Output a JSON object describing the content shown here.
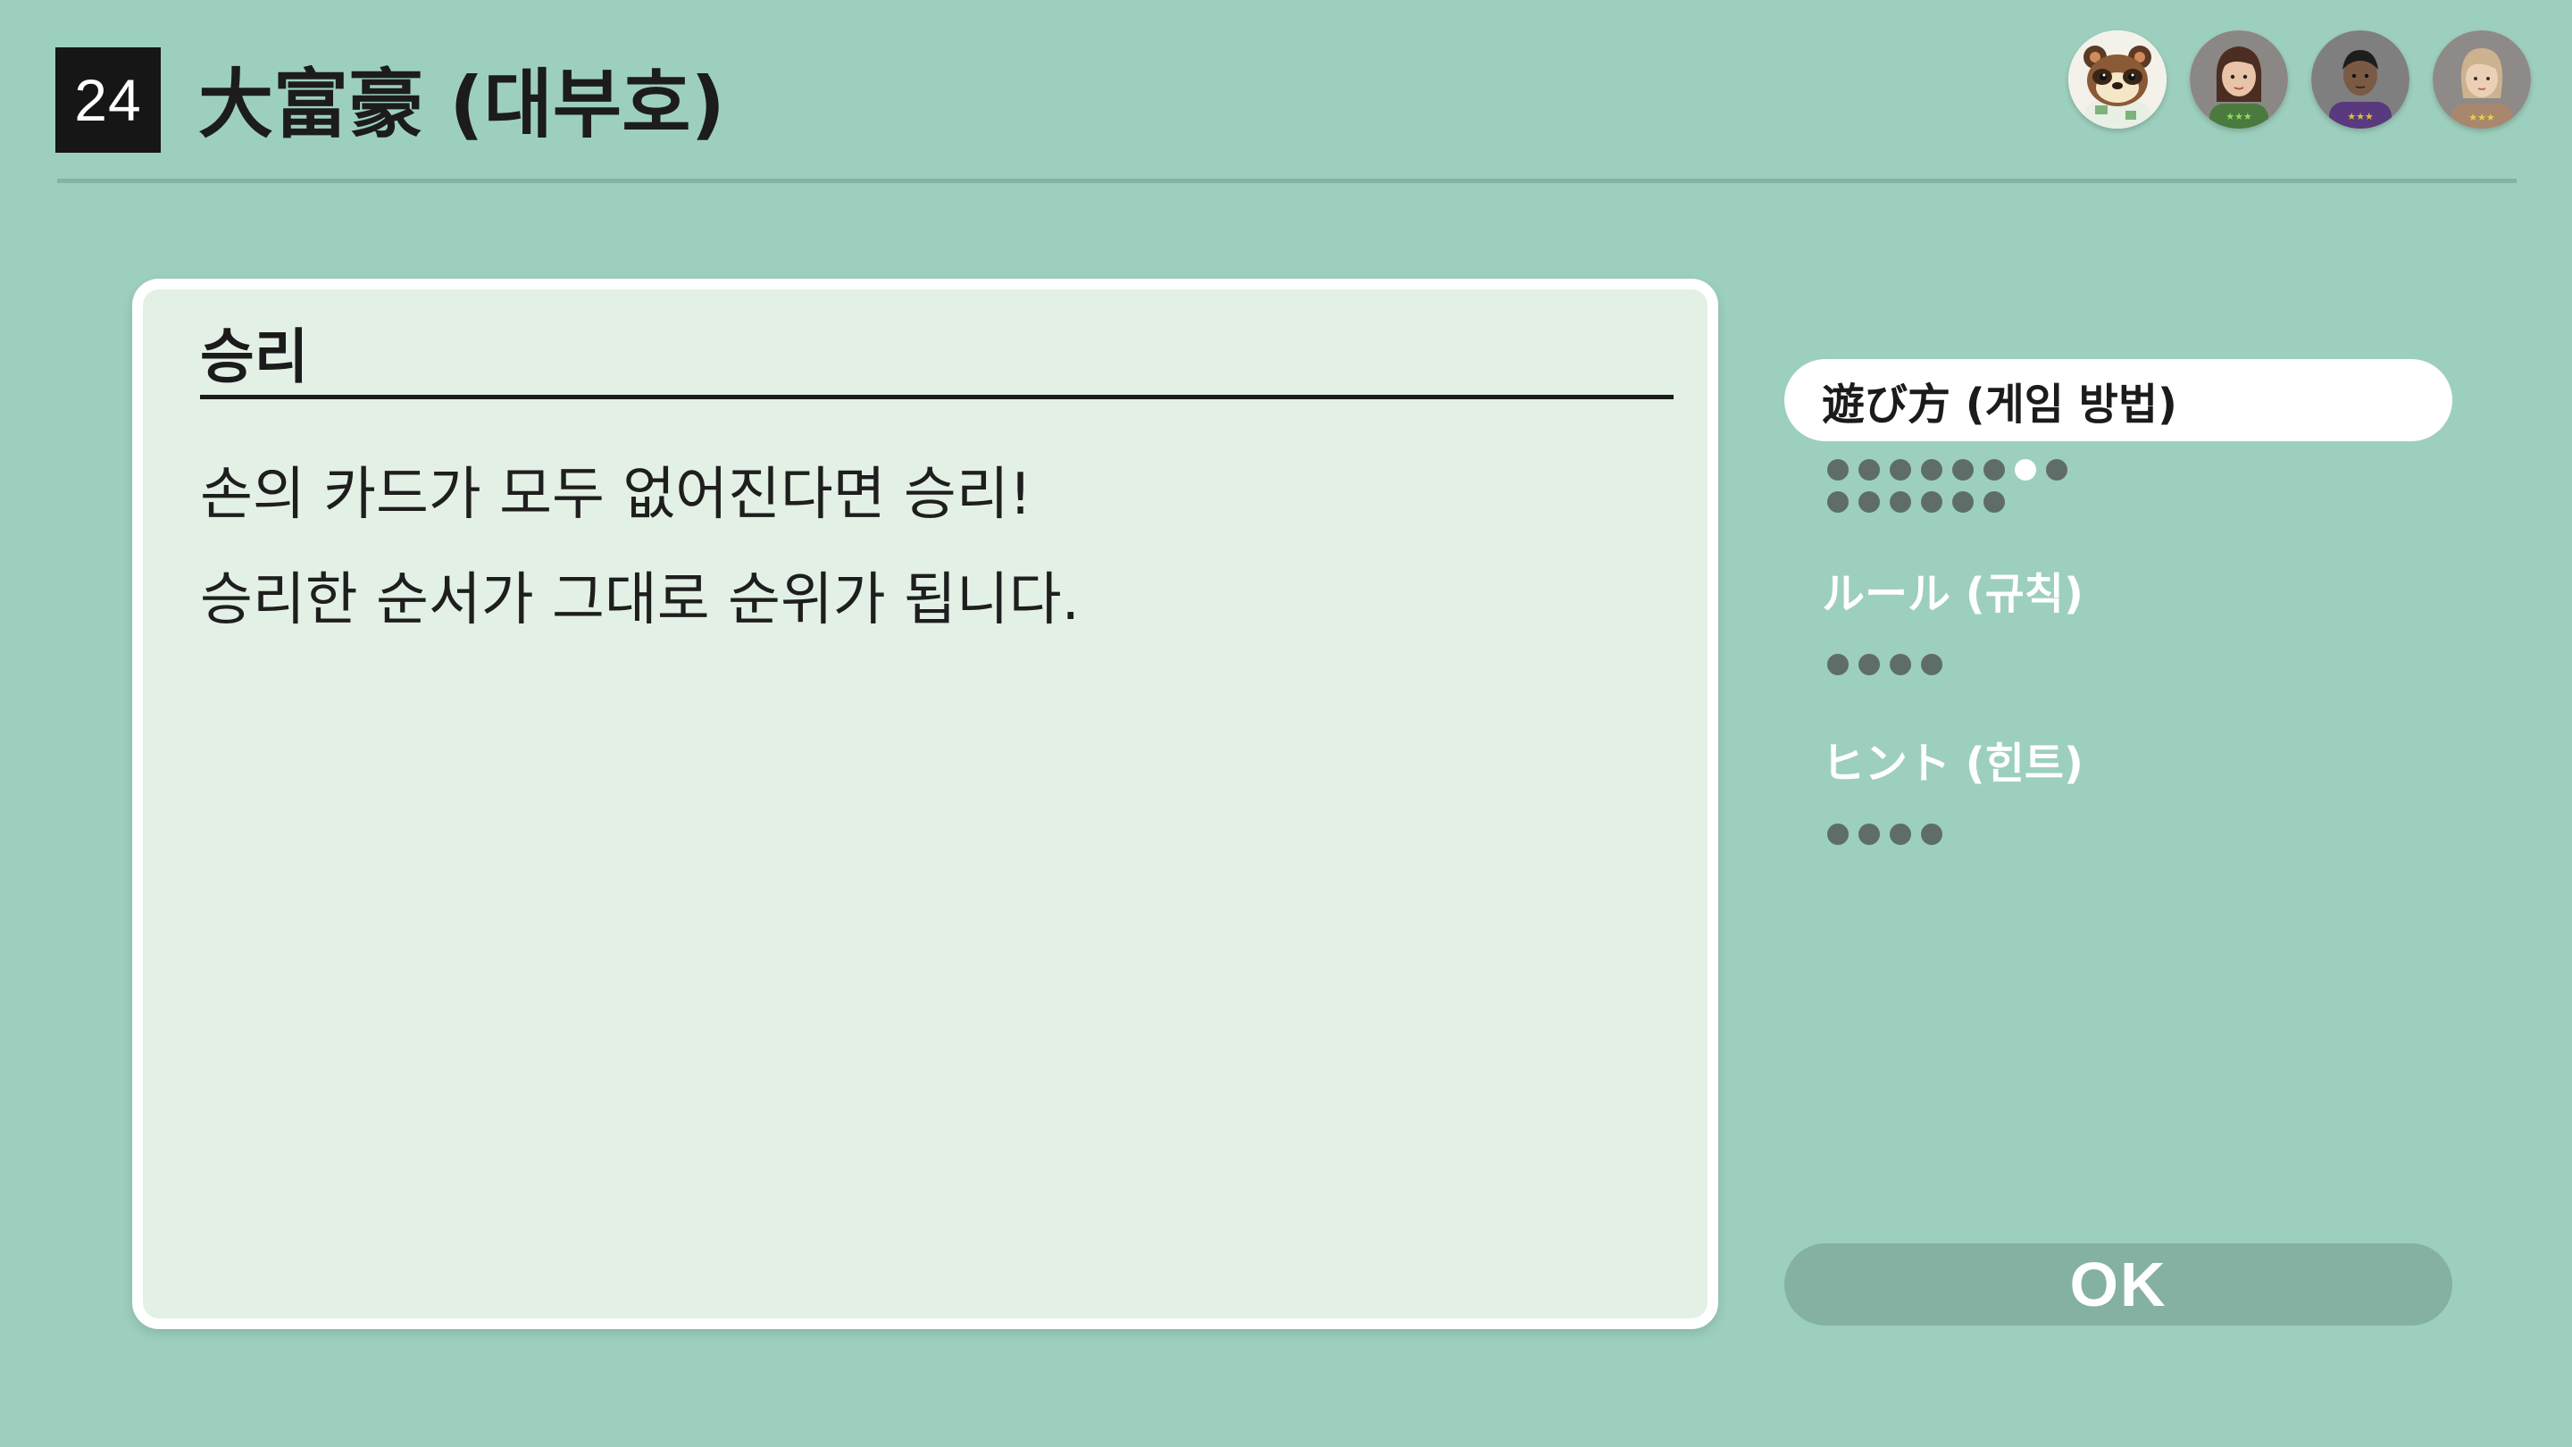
{
  "header": {
    "game_number": "24",
    "game_title": "大富豪 (대부호)"
  },
  "players": [
    {
      "name": "tom-nook-avatar-icon"
    },
    {
      "name": "female-mii-avatar-icon"
    },
    {
      "name": "male-mii-avatar-icon"
    },
    {
      "name": "light-haired-mii-avatar-icon"
    }
  ],
  "content": {
    "heading": "승리",
    "lines": [
      "손의 카드가 모두 없어진다면 승리!",
      "승리한 순서가 그대로 순위가 됩니다."
    ]
  },
  "menu": {
    "items": [
      {
        "label": "遊び方 (게임 방법)",
        "pages": 14,
        "current_page": 7
      },
      {
        "label": "ルール (규칙)",
        "pages": 4
      },
      {
        "label": "ヒント (힌트)",
        "pages": 4
      }
    ]
  },
  "ok_label": "OK",
  "colors": {
    "background": "#9dcfbe",
    "card": "#e3f0e5",
    "ok_button": "#85b1a2",
    "dot": "#5f6d68"
  }
}
